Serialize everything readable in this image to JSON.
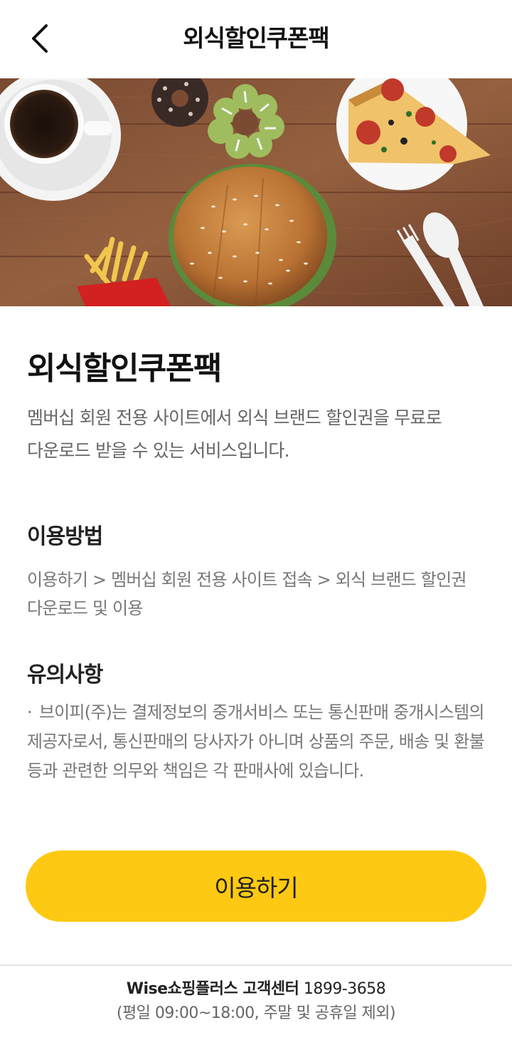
{
  "header": {
    "title": "외식할인쿠폰팩",
    "back_icon": "chevron-left-icon"
  },
  "hero": {
    "image_description_icon": "food-banner-image"
  },
  "main": {
    "title": "외식할인쿠폰팩",
    "description": "멤버십 회원 전용 사이트에서 외식 브랜드 할인권을 무료로 다운로드 받을 수 있는 서비스입니다.",
    "usage": {
      "title": "이용방법",
      "text": "이용하기 > 멤버십 회원 전용 사이트 접속 > 외식 브랜드 할인권 다운로드 및 이용"
    },
    "notice": {
      "title": "유의사항",
      "bullet": "·",
      "text": "브이피(주)는 결제정보의 중개서비스 또는 통신판매 중개시스템의 제공자로서, 통신판매의 당사자가 아니며 상품의 주문, 배송 및 환불 등과 관련한 의무와 책임은 각 판매사에 있습니다."
    }
  },
  "cta": {
    "label": "이용하기",
    "color": "#FDC912"
  },
  "footer": {
    "brand_line": "Wise쇼핑플러스 고객센터",
    "phone": "1899-3658",
    "hours": "(평일 09:00~18:00, 주말 및 공휴일 제외)"
  }
}
